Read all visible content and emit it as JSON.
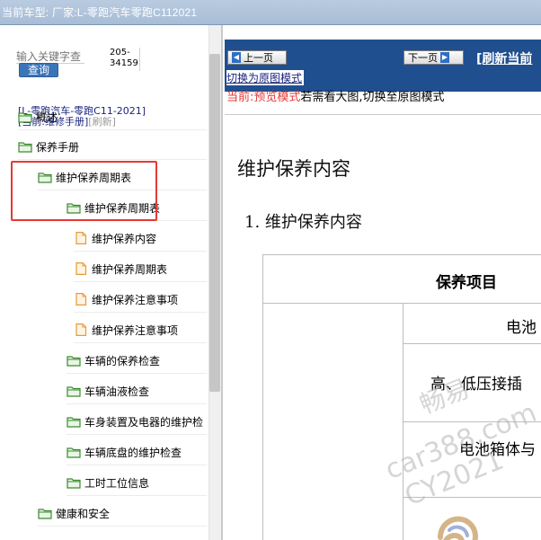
{
  "title_bar": {
    "text": "当前车型:   厂家:L-零跑汽车零跑C112021"
  },
  "sidebar": {
    "search_placeholder": "输入关键字查",
    "search_button": "查询",
    "code": "205-34159",
    "car_label": "[L-零跑汽车-零跑C11-2021]",
    "mode_label": "[当前:维修手册]",
    "refresh_label": "[刷新]",
    "tree": [
      {
        "label": "概述",
        "type": "folder"
      },
      {
        "label": "保养手册",
        "type": "folder"
      },
      {
        "label": "维护保养周期表",
        "type": "folder"
      },
      {
        "label": "维护保养周期表",
        "type": "folder"
      },
      {
        "label": "维护保养内容",
        "type": "file"
      },
      {
        "label": "维护保养周期表",
        "type": "file"
      },
      {
        "label": "维护保养注意事项",
        "type": "file"
      },
      {
        "label": "维护保养注意事项",
        "type": "file"
      },
      {
        "label": "车辆的保养检查",
        "type": "folder"
      },
      {
        "label": "车辆油液检查",
        "type": "folder"
      },
      {
        "label": "车身装置及电器的维护检",
        "type": "folder"
      },
      {
        "label": "车辆底盘的维护检查",
        "type": "folder"
      },
      {
        "label": "工时工位信息",
        "type": "folder"
      },
      {
        "label": "健康和安全",
        "type": "folder"
      }
    ]
  },
  "toolbar": {
    "prev_label": "上一页",
    "next_label": "下一页",
    "refresh_link": "[刷新当前"
  },
  "content": {
    "switch_link": "切换为原图模式",
    "preview_prefix": "当前:预览模式",
    "preview_suffix": "若需看大图,切换至原图模式",
    "heading": "维护保养内容",
    "subheading_num": "1.",
    "subheading_text": "维护保养内容",
    "table_header": "保养项目",
    "table_rows": [
      "电池",
      "高、低压接插",
      "电池箱体与"
    ]
  },
  "watermark": {
    "line1": "畅易",
    "line2": "car388.com",
    "line3": "CY2021"
  },
  "colors": {
    "accent": "#1f4f8f",
    "highlight": "#e53935",
    "preview_red": "#e53935",
    "button_blue": "#3a75b8"
  }
}
